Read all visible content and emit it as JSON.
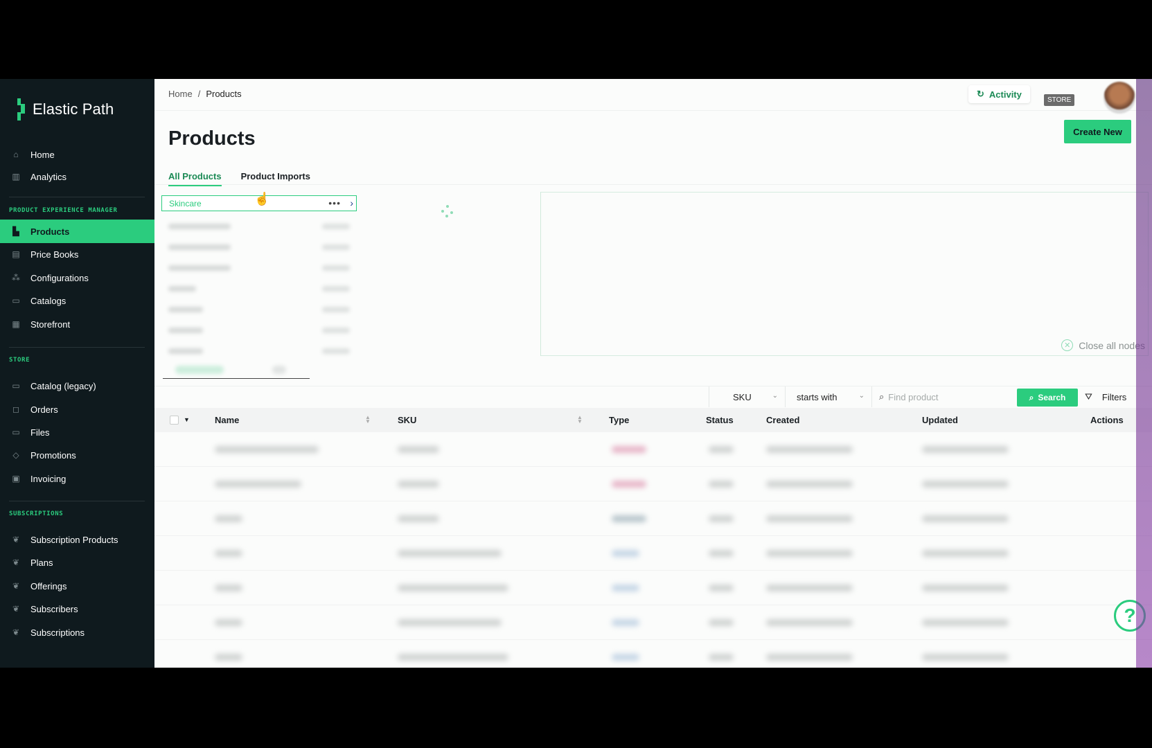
{
  "sidebar": {
    "brand": "Elastic Path",
    "top_items": [
      {
        "label": "Home",
        "icon": "home-icon"
      },
      {
        "label": "Analytics",
        "icon": "chart-icon"
      }
    ],
    "pxm_label": "PRODUCT EXPERIENCE MANAGER",
    "pxm_items": [
      {
        "label": "Products",
        "icon": "products-icon",
        "active": true
      },
      {
        "label": "Price Books",
        "icon": "pricebook-icon"
      },
      {
        "label": "Configurations",
        "icon": "hierarchy-icon"
      },
      {
        "label": "Catalogs",
        "icon": "catalog-icon"
      },
      {
        "label": "Storefront",
        "icon": "storefront-icon"
      }
    ],
    "store_label": "STORE",
    "store_items": [
      {
        "label": "Catalog (legacy)",
        "icon": "catalog-icon"
      },
      {
        "label": "Orders",
        "icon": "bag-icon"
      },
      {
        "label": "Files",
        "icon": "file-icon"
      },
      {
        "label": "Promotions",
        "icon": "tag-icon"
      },
      {
        "label": "Invoicing",
        "icon": "invoice-icon"
      }
    ],
    "subs_label": "SUBSCRIPTIONS",
    "subs_items": [
      {
        "label": "Subscription Products",
        "icon": "leaf-icon"
      },
      {
        "label": "Plans",
        "icon": "leaf-icon"
      },
      {
        "label": "Offerings",
        "icon": "leaf-icon"
      },
      {
        "label": "Subscribers",
        "icon": "leaf-icon"
      },
      {
        "label": "Subscriptions",
        "icon": "leaf-icon"
      }
    ]
  },
  "header": {
    "breadcrumb": [
      "Home",
      "Products"
    ],
    "breadcrumb_sep": "/",
    "activity_label": "Activity",
    "store_badge": "STORE"
  },
  "page": {
    "title": "Products",
    "create_label": "Create New",
    "tabs": [
      "All Products",
      "Product Imports"
    ]
  },
  "tree": {
    "selected_node": "Skincare",
    "more_label": "•••",
    "close_all_label": "Close all nodes"
  },
  "search": {
    "field": "SKU",
    "operator": "starts with",
    "placeholder": "Find product",
    "button_label": "Search",
    "filters_label": "Filters"
  },
  "table": {
    "columns": [
      "Name",
      "SKU",
      "Type",
      "Status",
      "Created",
      "Updated",
      "Actions"
    ]
  },
  "colors": {
    "accent": "#2bcc7e",
    "sidebar_bg": "#0f1a1e"
  }
}
